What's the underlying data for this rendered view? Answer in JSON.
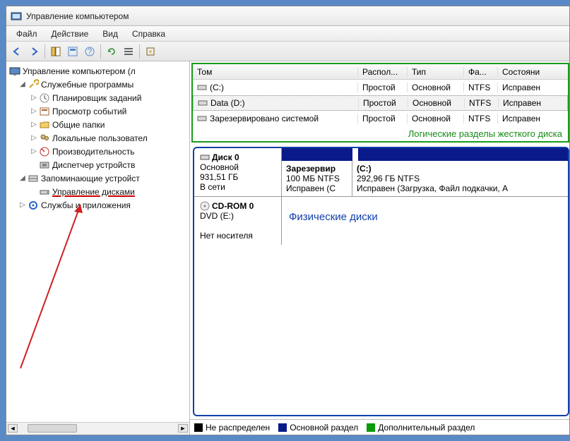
{
  "window": {
    "title": "Управление компьютером"
  },
  "menu": {
    "file": "Файл",
    "action": "Действие",
    "view": "Вид",
    "help": "Справка"
  },
  "tree": {
    "root": "Управление компьютером (л",
    "utilities": "Служебные программы",
    "scheduler": "Планировщик заданий",
    "eventviewer": "Просмотр событий",
    "shared": "Общие папки",
    "users": "Локальные пользовател",
    "perf": "Производительность",
    "devmgr": "Диспетчер устройств",
    "storage": "Запоминающие устройст",
    "diskmgmt": "Управление дисками",
    "services": "Службы и приложения"
  },
  "vol": {
    "head": {
      "tom": "Том",
      "layout": "Распол...",
      "type": "Тип",
      "fs": "Фа...",
      "state": "Состояни"
    },
    "rows": [
      {
        "name": "(C:)",
        "layout": "Простой",
        "type": "Основной",
        "fs": "NTFS",
        "state": "Исправен"
      },
      {
        "name": "Data (D:)",
        "layout": "Простой",
        "type": "Основной",
        "fs": "NTFS",
        "state": "Исправен"
      },
      {
        "name": "Зарезервировано системой",
        "layout": "Простой",
        "type": "Основной",
        "fs": "NTFS",
        "state": "Исправен"
      }
    ],
    "caption": "Логические разделы жесткого диска"
  },
  "disk0": {
    "title": "Диск 0",
    "kind": "Основной",
    "size": "931,51 ГБ",
    "status": "В сети",
    "p1": {
      "name": "Зарезервир",
      "size": "100 МБ NTFS",
      "state": "Исправен (С"
    },
    "p2": {
      "name": "(C:)",
      "size": "292,96 ГБ NTFS",
      "state": "Исправен (Загрузка, Файл подкачки, А"
    }
  },
  "cdrom": {
    "title": "CD-ROM 0",
    "kind": "DVD (E:)",
    "status": "Нет носителя",
    "caption": "Физические диски"
  },
  "legend": {
    "unalloc": "Не распределен",
    "primary": "Основной раздел",
    "ext": "Дополнительный раздел"
  }
}
